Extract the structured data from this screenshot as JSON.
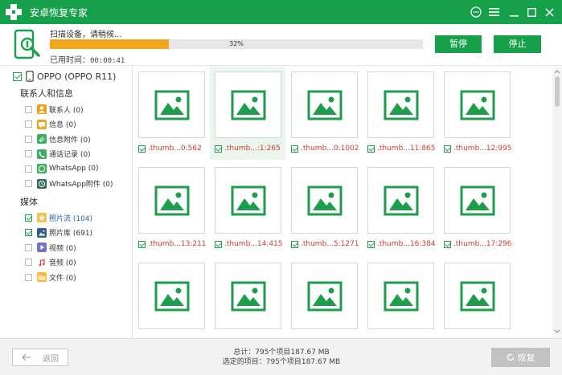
{
  "app": {
    "title": "安卓恢复专家"
  },
  "scan": {
    "status": "扫描设备，请稍候...",
    "progress_percent": 32,
    "progress_label": "32%",
    "elapsed_label": "已用时间：",
    "elapsed_value": "00:00:41",
    "pause_label": "暂停",
    "stop_label": "停止"
  },
  "sidebar": {
    "device": "OPPO (OPPO R11)",
    "contacts_section": "联系人和信息",
    "contacts_items": [
      {
        "label": "联系人 (0)",
        "icon": "contacts-icon"
      },
      {
        "label": "信息 (0)",
        "icon": "message-icon"
      },
      {
        "label": "信息附件 (0)",
        "icon": "attachment-icon"
      },
      {
        "label": "通话记录 (0)",
        "icon": "phone-icon"
      },
      {
        "label": "WhatsApp (0)",
        "icon": "whatsapp-icon"
      },
      {
        "label": "WhatsApp附件 (0)",
        "icon": "whatsapp-attachment-icon"
      }
    ],
    "media_section": "媒体",
    "media_items": [
      {
        "label": "照片流 (104)",
        "icon": "photo-stream-icon",
        "checked": true,
        "active": true
      },
      {
        "label": "照片库 (691)",
        "icon": "photo-library-icon",
        "checked": true
      },
      {
        "label": "视频 (0)",
        "icon": "video-icon"
      },
      {
        "label": "音频 (0)",
        "icon": "audio-icon"
      },
      {
        "label": "文件 (0)",
        "icon": "folder-icon"
      }
    ]
  },
  "grid": {
    "thumbnails": [
      {
        "caption": ".thumb...0:562"
      },
      {
        "caption": ".thumb...:1:265",
        "selected": true
      },
      {
        "caption": ".thumb...0:1002"
      },
      {
        "caption": ".thumb...11:865"
      },
      {
        "caption": ".thumb...12:995"
      },
      {
        "caption": ".thumb...13:211"
      },
      {
        "caption": ".thumb...14:415"
      },
      {
        "caption": ".thumb...5:1271"
      },
      {
        "caption": ".thumb...16:384"
      },
      {
        "caption": ".thumb...17:296"
      },
      {
        "caption": ""
      },
      {
        "caption": ""
      },
      {
        "caption": ""
      },
      {
        "caption": ""
      },
      {
        "caption": ""
      }
    ]
  },
  "footer": {
    "back_label": "返回",
    "total_line": "总计：795个项目187.67 MB",
    "selected_line": "选定的项目：795个项目187.67 MB",
    "recover_label": "恢复"
  },
  "colors": {
    "brand_green": "#16a04a",
    "progress_orange": "#f4a51e",
    "caption_red": "#d13a2a"
  }
}
